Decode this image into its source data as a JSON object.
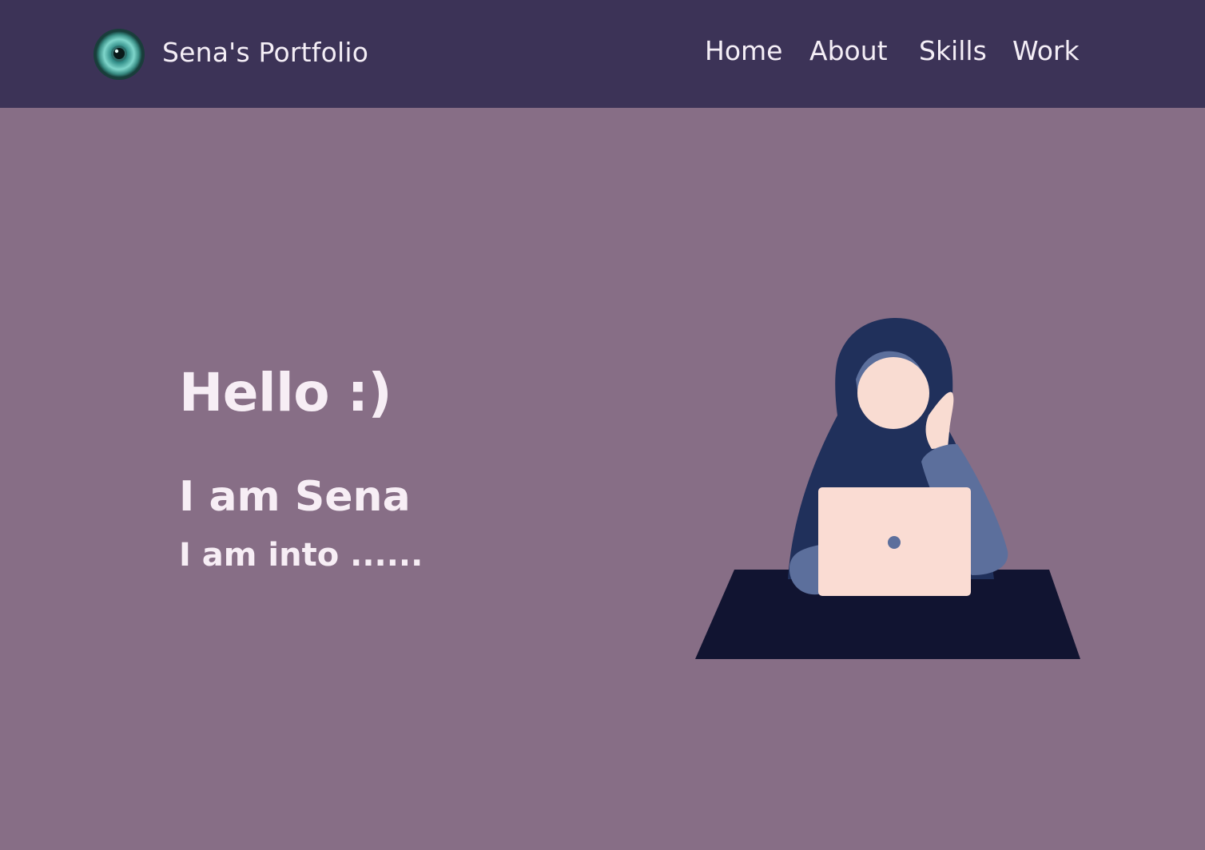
{
  "header": {
    "brand": "Sena's Portfolio",
    "logo_icon": "eye-icon",
    "nav": {
      "home": "Home",
      "about": "About",
      "skills": "Skills",
      "work": "Work"
    }
  },
  "hero": {
    "greeting": "Hello :)",
    "name_line": "I am Sena",
    "tagline": "I am into ......",
    "illustration": "woman-with-laptop-illustration"
  },
  "colors": {
    "nav_bg": "#3c3357",
    "page_bg": "#876e86",
    "text": "#f7eef5"
  }
}
